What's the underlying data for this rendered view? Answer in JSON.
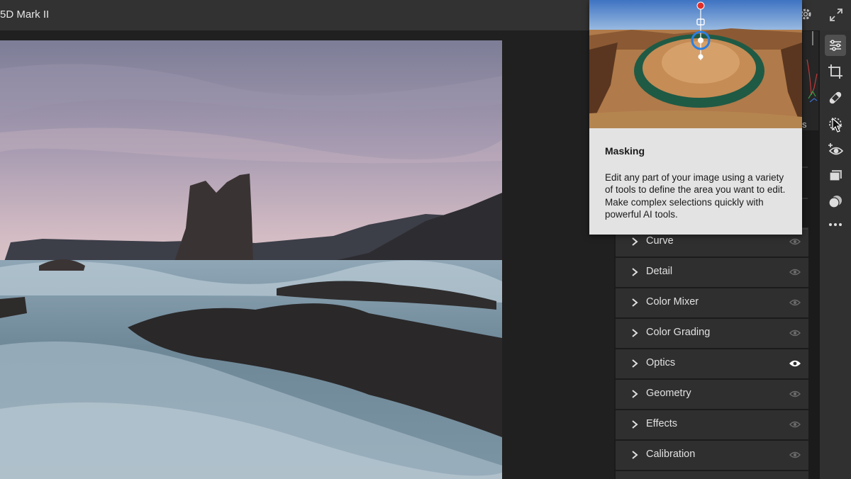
{
  "header": {
    "camera_label": "5D Mark II",
    "settings_icon": "gear-icon",
    "expand_icon": "expand-icon"
  },
  "tooltip": {
    "title": "Masking",
    "description": "Edit any part of your image using a variety of tools to define the area you want to edit. Make complex selections quickly with powerful AI tools."
  },
  "edit_panel": {
    "partial_label": "s",
    "sections": [
      {
        "label": "Curve",
        "visible": true
      },
      {
        "label": "Detail",
        "visible": true
      },
      {
        "label": "Color Mixer",
        "visible": true
      },
      {
        "label": "Color Grading",
        "visible": true
      },
      {
        "label": "Optics",
        "visible": true,
        "highlighted": true
      },
      {
        "label": "Geometry",
        "visible": true
      },
      {
        "label": "Effects",
        "visible": true
      },
      {
        "label": "Calibration",
        "visible": true
      }
    ]
  },
  "tool_strip": [
    {
      "icon": "sliders-icon",
      "label": "Edit",
      "active": true
    },
    {
      "icon": "crop-icon",
      "label": "Crop"
    },
    {
      "icon": "bandage-icon",
      "label": "Healing"
    },
    {
      "icon": "masking-icon",
      "label": "Masking"
    },
    {
      "icon": "red-eye-icon",
      "label": "Red Eye"
    },
    {
      "icon": "presets-icon",
      "label": "Presets"
    },
    {
      "icon": "versions-icon",
      "label": "Versions"
    },
    {
      "icon": "more-icon",
      "label": "More"
    }
  ],
  "colors": {
    "topbar": "#323232",
    "panel_bg": "#1b1b1b",
    "panel_row": "#2f2f2f",
    "tool_strip": "#303030",
    "tooltip_bg": "#e3e3e3",
    "mask_accent": "#2a7fe0",
    "record_dot": "#e0302a"
  }
}
